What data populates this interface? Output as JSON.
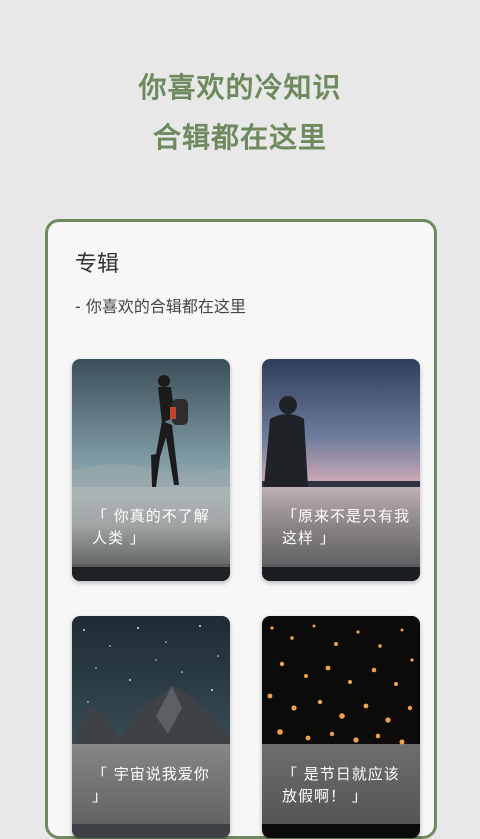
{
  "hero": {
    "line1": "你喜欢的冷知识",
    "line2": "合辑都在这里"
  },
  "album": {
    "title": "专辑",
    "subtitle": "- 你喜欢的合辑都在这里",
    "cards": [
      {
        "caption": "「 你真的不了解人类 」",
        "image": "hiker-silhouette"
      },
      {
        "caption": "「原来不是只有我这样 」",
        "image": "person-at-sea"
      },
      {
        "caption": "「 宇宙说我爱你 」",
        "image": "starry-mountain"
      },
      {
        "caption": "「 是节日就应该放假啊！ 」",
        "image": "floating-lanterns"
      }
    ]
  },
  "colors": {
    "accent": "#6f8a5e",
    "background": "#e8e8e8"
  }
}
